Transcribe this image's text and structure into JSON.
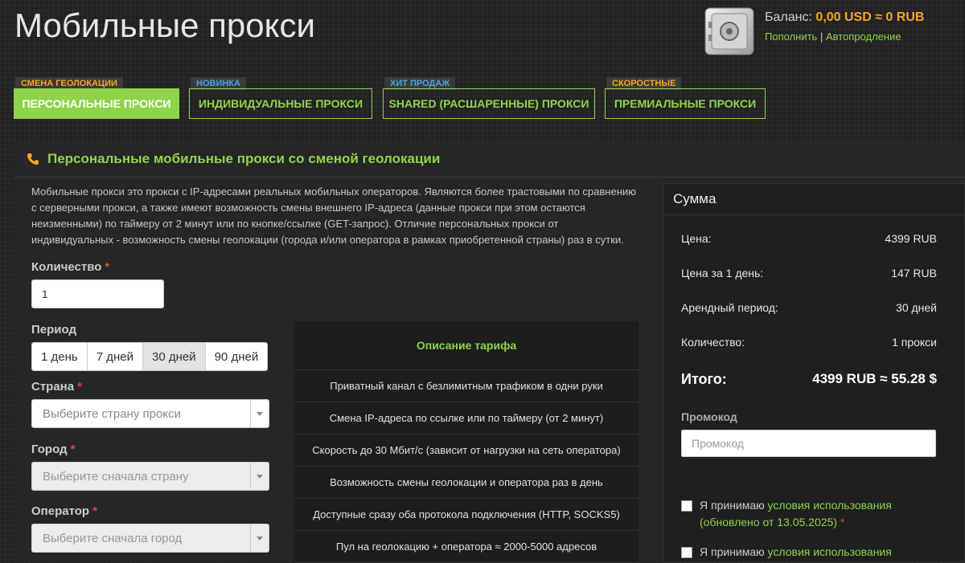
{
  "page": {
    "title": "Мобильные прокси"
  },
  "balance": {
    "label": "Баланс:",
    "amount": "0,00 USD ≈ 0 RUB",
    "topup": "Пополнить",
    "separator": "|",
    "autorenew": "Автопродление"
  },
  "tabs": [
    {
      "badge": "СМЕНА ГЕОЛОКАЦИИ",
      "badge_color": "#f5a623",
      "label": "ПЕРСОНАЛЬНЫЕ ПРОКСИ",
      "active": true
    },
    {
      "badge": "НОВИНКА",
      "badge_color": "#4aa3df",
      "label": "ИНДИВИДУАЛЬНЫЕ ПРОКСИ",
      "active": false
    },
    {
      "badge": "ХИТ ПРОДАЖ",
      "badge_color": "#4aa3df",
      "label": "SHARED (РАСШАРЕННЫЕ) ПРОКСИ",
      "active": false
    },
    {
      "badge": "СКОРОСТНЫЕ",
      "badge_color": "#f5a623",
      "label": "ПРЕМИАЛЬНЫЕ ПРОКСИ",
      "active": false
    }
  ],
  "panel": {
    "title": "Персональные мобильные прокси со сменой геолокации",
    "description": "Мобильные прокси это прокси с IP-адресами реальных мобильных операторов. Являются более трастовыми по сравнению с серверными прокси, а также имеют возможность смены внешнего IP-адреса (данные прокси при этом остаются неизменными) по таймеру от 2 минут или по кнопке/ссылке (GET-запрос). Отличие персональных прокси от индивидуальных - возможность смены геолокации (города и/или оператора в рамках приобретенной страны) раз в сутки."
  },
  "form": {
    "quantity_label": "Количество",
    "quantity_value": "1",
    "required_mark": "*",
    "period_label": "Период",
    "periods": [
      "1 день",
      "7 дней",
      "30 дней",
      "90 дней"
    ],
    "period_selected": "30 дней",
    "country_label": "Страна",
    "country_placeholder": "Выберите страну прокси",
    "city_label": "Город",
    "city_placeholder": "Выберите сначала страну",
    "operator_label": "Оператор",
    "operator_placeholder": "Выберите сначала город"
  },
  "tariff": {
    "title": "Описание тарифа",
    "rows": [
      "Приватный канал с безлимитным трафиком в одни руки",
      "Смена IP-адреса по ссылке или по таймеру (от 2 минут)",
      "Скорость до 30 Мбит/с (зависит от нагрузки на сеть оператора)",
      "Возможность смены геолокации и оператора раз в день",
      "Доступные сразу оба протокола подключения (HTTP, SOCKS5)",
      "Пул на геолокацию + оператора ≈ 2000-5000 адресов"
    ]
  },
  "summary": {
    "title": "Сумма",
    "price_label": "Цена:",
    "price_value": "4399 RUB",
    "per_day_label": "Цена за 1 день:",
    "per_day_value": "147 RUB",
    "period_label": "Арендный период:",
    "period_value": "30 дней",
    "qty_label": "Количество:",
    "qty_value": "1 прокси",
    "total_label": "Итого:",
    "total_value": "4399 RUB ≈ 55.28 $",
    "promo_label": "Промокод",
    "promo_placeholder": "Промокод",
    "agree1_prefix": "Я принимаю",
    "agree1_link": "условия использования",
    "agree1_suffix": "(обновлено от 13.05.2025)",
    "agree2_prefix": "Я принимаю",
    "agree2_link": "условия использования"
  },
  "colors": {
    "accent_green": "#8ed44a",
    "accent_orange": "#f5a623",
    "required_red": "#e0443a"
  }
}
